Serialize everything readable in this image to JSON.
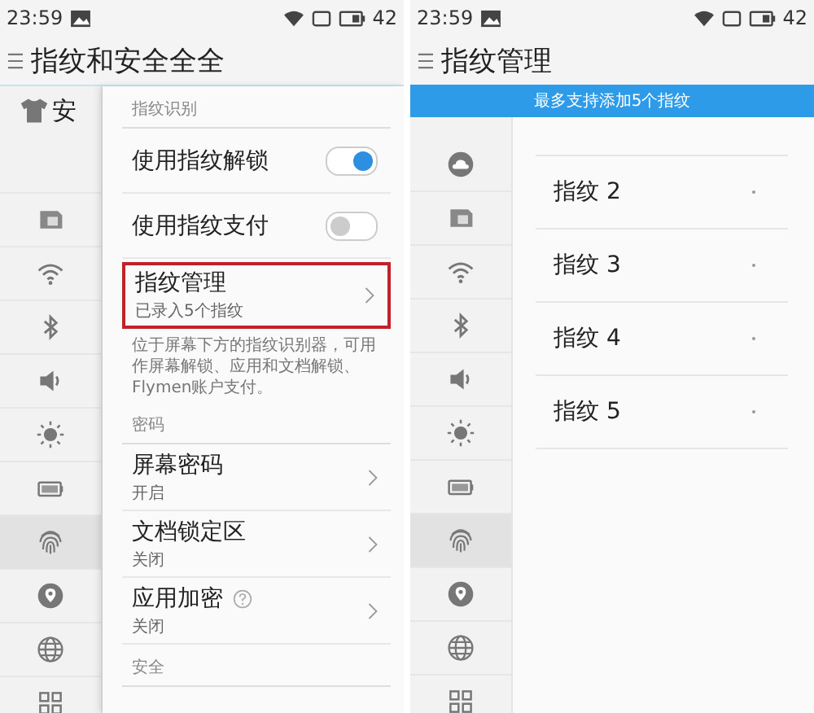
{
  "screens": [
    {
      "status_bar": {
        "time": "23:59",
        "battery": "42"
      },
      "title": "指纹和安全全全",
      "sidebar": {
        "items": [
          {
            "kind": "shirt",
            "label": "安",
            "selected": false
          },
          {
            "kind": "sim",
            "selected": false
          },
          {
            "kind": "wifi",
            "selected": false
          },
          {
            "kind": "bluetooth",
            "selected": false
          },
          {
            "kind": "volume",
            "selected": false
          },
          {
            "kind": "brightness",
            "selected": false
          },
          {
            "kind": "battery",
            "selected": false
          },
          {
            "kind": "fingerprint",
            "selected": true
          },
          {
            "kind": "location",
            "selected": false
          },
          {
            "kind": "globe",
            "selected": false
          },
          {
            "kind": "apps",
            "selected": false
          }
        ]
      },
      "sections": [
        {
          "header": "指纹识别",
          "rows": [
            {
              "kind": "toggle",
              "label": "使用指纹解锁",
              "on": true
            },
            {
              "kind": "toggle",
              "label": "使用指纹支付",
              "on": false
            },
            {
              "kind": "link",
              "label": "指纹管理",
              "sub": "已录入5个指纹",
              "highlighted": true,
              "help": false
            }
          ],
          "note": "位于屏幕下方的指纹识别器，可用作屏幕解锁、应用和文档解锁、Flymen账户支付。"
        },
        {
          "header": "密码",
          "rows": [
            {
              "kind": "link",
              "label": "屏幕密码",
              "sub": "开启",
              "highlighted": false,
              "help": false
            },
            {
              "kind": "link",
              "label": "文档锁定区",
              "sub": "关闭",
              "highlighted": false,
              "help": false
            },
            {
              "kind": "link",
              "label": "应用加密",
              "sub": "关闭",
              "highlighted": false,
              "help": true
            }
          ]
        },
        {
          "header": "安全"
        }
      ]
    },
    {
      "status_bar": {
        "time": "23:59",
        "battery": "42"
      },
      "title": "指纹管理",
      "toast": "最多支持添加5个指纹",
      "sidebar": {
        "items": [
          {
            "kind": "cloud",
            "selected": false
          },
          {
            "kind": "sim",
            "selected": false
          },
          {
            "kind": "wifi",
            "selected": false
          },
          {
            "kind": "bluetooth",
            "selected": false
          },
          {
            "kind": "volume",
            "selected": false
          },
          {
            "kind": "brightness",
            "selected": false
          },
          {
            "kind": "battery",
            "selected": false
          },
          {
            "kind": "fingerprint",
            "selected": true
          },
          {
            "kind": "location",
            "selected": false
          },
          {
            "kind": "globe",
            "selected": false
          },
          {
            "kind": "apps",
            "selected": false
          }
        ]
      },
      "fingerprints": [
        "指纹 2",
        "指纹 3",
        "指纹 4",
        "指纹 5"
      ]
    }
  ]
}
